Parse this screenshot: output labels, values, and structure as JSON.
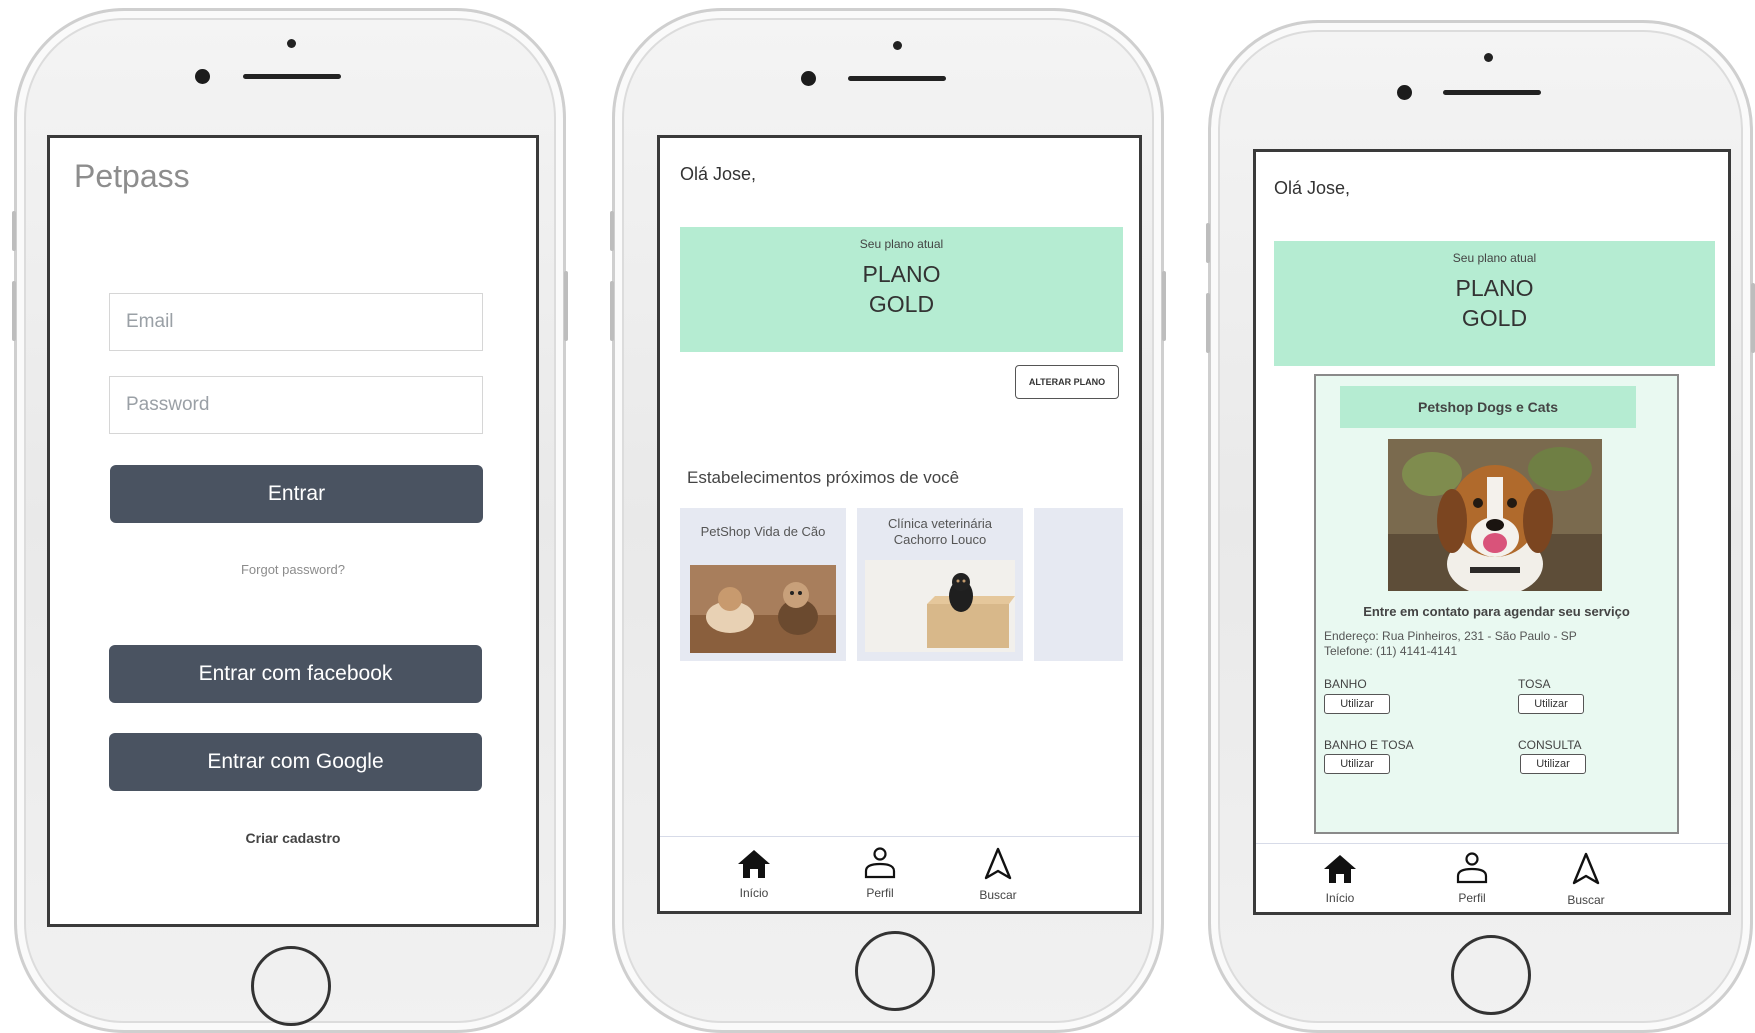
{
  "login": {
    "app_title": "Petpass",
    "email_placeholder": "Email",
    "password_placeholder": "Password",
    "login_button": "Entrar",
    "forgot_password": "Forgot password?",
    "facebook_button": "Entrar com facebook",
    "google_button": "Entrar com Google",
    "register_link": "Criar cadastro"
  },
  "home": {
    "greeting": "Olá Jose,",
    "plan_caption": "Seu plano atual",
    "plan_line1": "PLANO",
    "plan_line2": "GOLD",
    "change_plan_button": "ALTERAR PLANO",
    "nearby_heading": "Estabelecimentos próximos de você",
    "places": [
      {
        "name": "PetShop Vida de Cão"
      },
      {
        "name_line1": "Clínica veterinária",
        "name_line2": "Cachorro Louco"
      }
    ]
  },
  "detail": {
    "greeting": "Olá Jose,",
    "plan_caption": "Seu plano atual",
    "plan_line1": "PLANO",
    "plan_line2": "GOLD",
    "shop_name": "Petshop Dogs e Cats",
    "contact_heading": "Entre em contato para agendar seu serviço",
    "address": "Endereço: Rua Pinheiros, 231 - São Paulo - SP",
    "phone": "Telefone: (11) 4141-4141",
    "services": [
      {
        "name": "BANHO",
        "button": "Utilizar"
      },
      {
        "name": "TOSA",
        "button": "Utilizar"
      },
      {
        "name": "BANHO E TOSA",
        "button": "Utilizar"
      },
      {
        "name": "CONSULTA",
        "button": "Utilizar"
      }
    ]
  },
  "tabbar": {
    "home_label": "Início",
    "profile_label": "Perfil",
    "search_label": "Buscar",
    "home_icon": "home-icon",
    "profile_icon": "user-icon",
    "search_icon": "navigation-arrow-icon"
  },
  "colors": {
    "accent_green": "#b5ecd2",
    "dark_button": "#4a5361",
    "card_bg": "#e6e9f2",
    "detail_panel_bg": "#e9f9f1"
  }
}
